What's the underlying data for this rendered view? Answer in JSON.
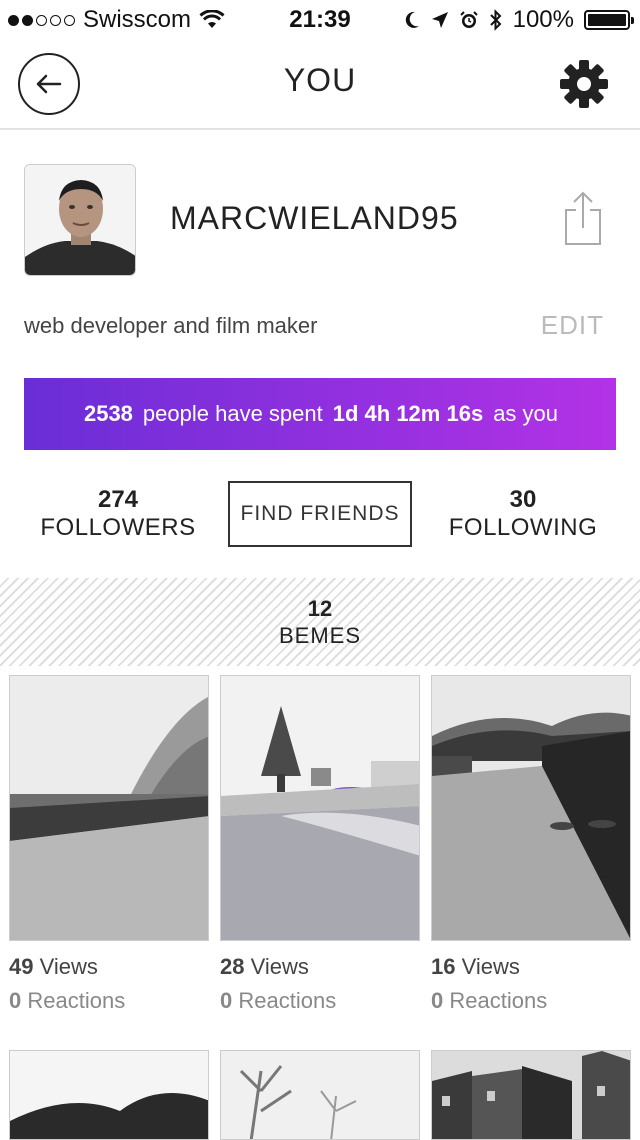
{
  "status_bar": {
    "carrier": "Swisscom",
    "time": "21:39",
    "battery": "100%",
    "battery_level": 1.0,
    "signal_bars": 2,
    "icons": [
      "wifi-icon",
      "moon-icon",
      "location-icon",
      "alarm-icon",
      "bluetooth-icon"
    ]
  },
  "nav": {
    "title": "YOU",
    "back_icon": "back-arrow-icon",
    "settings_icon": "gear-icon"
  },
  "profile": {
    "username": "MARCWIELAND95",
    "bio": "web developer and film maker",
    "edit_label": "EDIT",
    "share_icon": "share-icon"
  },
  "banner": {
    "count": "2538",
    "text_mid": "people have spent",
    "duration": "1d 4h 12m 16s",
    "text_end": "as you",
    "gradient_start": "#6a2ed6",
    "gradient_end": "#b332e6"
  },
  "stats": {
    "followers_count": "274",
    "followers_label": "FOLLOWERS",
    "find_friends_label": "FIND FRIENDS",
    "following_count": "30",
    "following_label": "FOLLOWING"
  },
  "bemes": {
    "count": "12",
    "label": "BEMES"
  },
  "posts": [
    {
      "views": "49",
      "views_label": "Views",
      "reactions": "0",
      "reactions_label": "Reactions"
    },
    {
      "views": "28",
      "views_label": "Views",
      "reactions": "0",
      "reactions_label": "Reactions"
    },
    {
      "views": "16",
      "views_label": "Views",
      "reactions": "0",
      "reactions_label": "Reactions"
    }
  ]
}
